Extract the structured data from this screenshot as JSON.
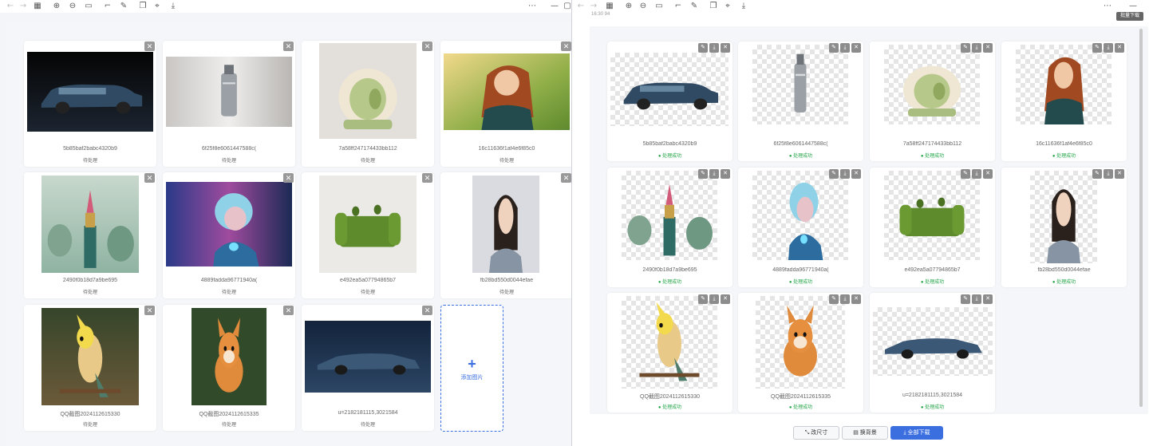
{
  "toolbar": {
    "icons": [
      "back-arrow-icon",
      "forward-arrow-icon",
      "grid-icon",
      "zoom-in-icon",
      "zoom-out-icon",
      "fit-icon",
      "crop-icon",
      "edit-icon",
      "copy-icon",
      "focus-icon",
      "download-icon",
      "more-icon",
      "minimize-icon"
    ]
  },
  "left_panel": {
    "cards": [
      {
        "filename": "5b85baf2babc4320b9",
        "status": "待处理"
      },
      {
        "filename": "6f25f8e6061447588c(",
        "status": "待处理"
      },
      {
        "filename": "7a58ff247174433bb112",
        "status": "待处理"
      },
      {
        "filename": "16c11636f1af4e6f85c0",
        "status": "待处理"
      },
      {
        "filename": "2490f0b18d7a9be695",
        "status": "待处理"
      },
      {
        "filename": "4889fadda96771940a(",
        "status": "待处理"
      },
      {
        "filename": "e492ea5a07794865b7",
        "status": "待处理"
      },
      {
        "filename": "fb28bd550d0044efae",
        "status": "待处理"
      },
      {
        "filename": "QQ截图2024112615330",
        "status": "待处理"
      },
      {
        "filename": "QQ截图2024112615335",
        "status": "待处理"
      },
      {
        "filename": "u=2182181115,3021584",
        "status": "待处理"
      }
    ],
    "add_label": "添加图片",
    "add_symbol": "+"
  },
  "right_panel": {
    "top_partial_text": "16:30 94",
    "top_right_badge": "批量下载",
    "cards": [
      {
        "filename": "5b85baf2babc4320b9",
        "status": "处理成功"
      },
      {
        "filename": "6f25f8e6061447588c(",
        "status": "处理成功"
      },
      {
        "filename": "7a58ff247174433bb112",
        "status": "处理成功"
      },
      {
        "filename": "16c11636f1af4e6f85c0",
        "status": "处理成功"
      },
      {
        "filename": "2490f0b18d7a9be695",
        "status": "处理成功"
      },
      {
        "filename": "4889fadda96771940a(",
        "status": "处理成功"
      },
      {
        "filename": "e492ea5a07794865b7",
        "status": "处理成功"
      },
      {
        "filename": "fb28bd550d0044efae",
        "status": "处理成功"
      },
      {
        "filename": "QQ截图2024112615330",
        "status": "处理成功"
      },
      {
        "filename": "QQ截图2024112615335",
        "status": "处理成功"
      },
      {
        "filename": "u=2182181115,3021584",
        "status": "处理成功"
      }
    ],
    "buttons": {
      "resize": "改尺寸",
      "background": "换背景",
      "download_all": "全部下载"
    }
  },
  "colors": {
    "accent": "#3b6fe0",
    "success": "#22a447"
  }
}
